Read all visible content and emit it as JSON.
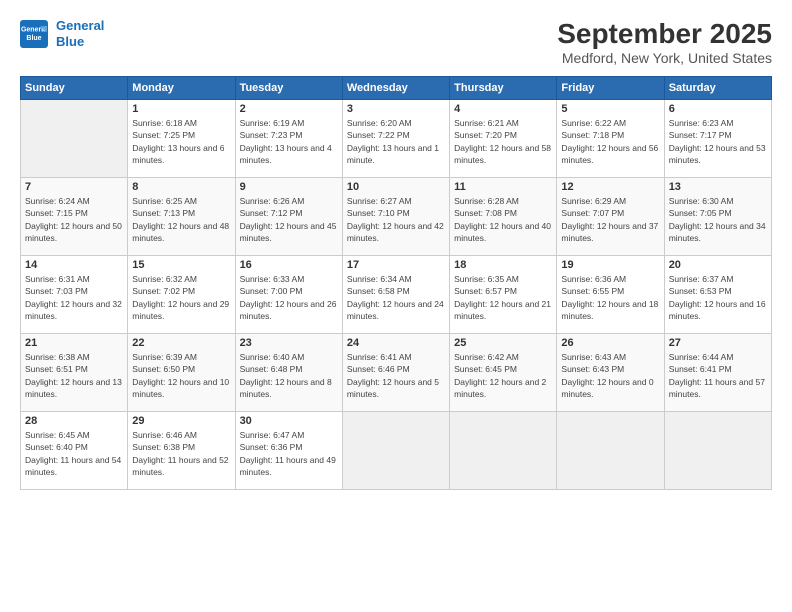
{
  "header": {
    "logo_line1": "General",
    "logo_line2": "Blue",
    "title": "September 2025",
    "subtitle": "Medford, New York, United States"
  },
  "weekdays": [
    "Sunday",
    "Monday",
    "Tuesday",
    "Wednesday",
    "Thursday",
    "Friday",
    "Saturday"
  ],
  "weeks": [
    [
      {
        "day": "",
        "sunrise": "",
        "sunset": "",
        "daylight": ""
      },
      {
        "day": "1",
        "sunrise": "Sunrise: 6:18 AM",
        "sunset": "Sunset: 7:25 PM",
        "daylight": "Daylight: 13 hours and 6 minutes."
      },
      {
        "day": "2",
        "sunrise": "Sunrise: 6:19 AM",
        "sunset": "Sunset: 7:23 PM",
        "daylight": "Daylight: 13 hours and 4 minutes."
      },
      {
        "day": "3",
        "sunrise": "Sunrise: 6:20 AM",
        "sunset": "Sunset: 7:22 PM",
        "daylight": "Daylight: 13 hours and 1 minute."
      },
      {
        "day": "4",
        "sunrise": "Sunrise: 6:21 AM",
        "sunset": "Sunset: 7:20 PM",
        "daylight": "Daylight: 12 hours and 58 minutes."
      },
      {
        "day": "5",
        "sunrise": "Sunrise: 6:22 AM",
        "sunset": "Sunset: 7:18 PM",
        "daylight": "Daylight: 12 hours and 56 minutes."
      },
      {
        "day": "6",
        "sunrise": "Sunrise: 6:23 AM",
        "sunset": "Sunset: 7:17 PM",
        "daylight": "Daylight: 12 hours and 53 minutes."
      }
    ],
    [
      {
        "day": "7",
        "sunrise": "Sunrise: 6:24 AM",
        "sunset": "Sunset: 7:15 PM",
        "daylight": "Daylight: 12 hours and 50 minutes."
      },
      {
        "day": "8",
        "sunrise": "Sunrise: 6:25 AM",
        "sunset": "Sunset: 7:13 PM",
        "daylight": "Daylight: 12 hours and 48 minutes."
      },
      {
        "day": "9",
        "sunrise": "Sunrise: 6:26 AM",
        "sunset": "Sunset: 7:12 PM",
        "daylight": "Daylight: 12 hours and 45 minutes."
      },
      {
        "day": "10",
        "sunrise": "Sunrise: 6:27 AM",
        "sunset": "Sunset: 7:10 PM",
        "daylight": "Daylight: 12 hours and 42 minutes."
      },
      {
        "day": "11",
        "sunrise": "Sunrise: 6:28 AM",
        "sunset": "Sunset: 7:08 PM",
        "daylight": "Daylight: 12 hours and 40 minutes."
      },
      {
        "day": "12",
        "sunrise": "Sunrise: 6:29 AM",
        "sunset": "Sunset: 7:07 PM",
        "daylight": "Daylight: 12 hours and 37 minutes."
      },
      {
        "day": "13",
        "sunrise": "Sunrise: 6:30 AM",
        "sunset": "Sunset: 7:05 PM",
        "daylight": "Daylight: 12 hours and 34 minutes."
      }
    ],
    [
      {
        "day": "14",
        "sunrise": "Sunrise: 6:31 AM",
        "sunset": "Sunset: 7:03 PM",
        "daylight": "Daylight: 12 hours and 32 minutes."
      },
      {
        "day": "15",
        "sunrise": "Sunrise: 6:32 AM",
        "sunset": "Sunset: 7:02 PM",
        "daylight": "Daylight: 12 hours and 29 minutes."
      },
      {
        "day": "16",
        "sunrise": "Sunrise: 6:33 AM",
        "sunset": "Sunset: 7:00 PM",
        "daylight": "Daylight: 12 hours and 26 minutes."
      },
      {
        "day": "17",
        "sunrise": "Sunrise: 6:34 AM",
        "sunset": "Sunset: 6:58 PM",
        "daylight": "Daylight: 12 hours and 24 minutes."
      },
      {
        "day": "18",
        "sunrise": "Sunrise: 6:35 AM",
        "sunset": "Sunset: 6:57 PM",
        "daylight": "Daylight: 12 hours and 21 minutes."
      },
      {
        "day": "19",
        "sunrise": "Sunrise: 6:36 AM",
        "sunset": "Sunset: 6:55 PM",
        "daylight": "Daylight: 12 hours and 18 minutes."
      },
      {
        "day": "20",
        "sunrise": "Sunrise: 6:37 AM",
        "sunset": "Sunset: 6:53 PM",
        "daylight": "Daylight: 12 hours and 16 minutes."
      }
    ],
    [
      {
        "day": "21",
        "sunrise": "Sunrise: 6:38 AM",
        "sunset": "Sunset: 6:51 PM",
        "daylight": "Daylight: 12 hours and 13 minutes."
      },
      {
        "day": "22",
        "sunrise": "Sunrise: 6:39 AM",
        "sunset": "Sunset: 6:50 PM",
        "daylight": "Daylight: 12 hours and 10 minutes."
      },
      {
        "day": "23",
        "sunrise": "Sunrise: 6:40 AM",
        "sunset": "Sunset: 6:48 PM",
        "daylight": "Daylight: 12 hours and 8 minutes."
      },
      {
        "day": "24",
        "sunrise": "Sunrise: 6:41 AM",
        "sunset": "Sunset: 6:46 PM",
        "daylight": "Daylight: 12 hours and 5 minutes."
      },
      {
        "day": "25",
        "sunrise": "Sunrise: 6:42 AM",
        "sunset": "Sunset: 6:45 PM",
        "daylight": "Daylight: 12 hours and 2 minutes."
      },
      {
        "day": "26",
        "sunrise": "Sunrise: 6:43 AM",
        "sunset": "Sunset: 6:43 PM",
        "daylight": "Daylight: 12 hours and 0 minutes."
      },
      {
        "day": "27",
        "sunrise": "Sunrise: 6:44 AM",
        "sunset": "Sunset: 6:41 PM",
        "daylight": "Daylight: 11 hours and 57 minutes."
      }
    ],
    [
      {
        "day": "28",
        "sunrise": "Sunrise: 6:45 AM",
        "sunset": "Sunset: 6:40 PM",
        "daylight": "Daylight: 11 hours and 54 minutes."
      },
      {
        "day": "29",
        "sunrise": "Sunrise: 6:46 AM",
        "sunset": "Sunset: 6:38 PM",
        "daylight": "Daylight: 11 hours and 52 minutes."
      },
      {
        "day": "30",
        "sunrise": "Sunrise: 6:47 AM",
        "sunset": "Sunset: 6:36 PM",
        "daylight": "Daylight: 11 hours and 49 minutes."
      },
      {
        "day": "",
        "sunrise": "",
        "sunset": "",
        "daylight": ""
      },
      {
        "day": "",
        "sunrise": "",
        "sunset": "",
        "daylight": ""
      },
      {
        "day": "",
        "sunrise": "",
        "sunset": "",
        "daylight": ""
      },
      {
        "day": "",
        "sunrise": "",
        "sunset": "",
        "daylight": ""
      }
    ]
  ]
}
